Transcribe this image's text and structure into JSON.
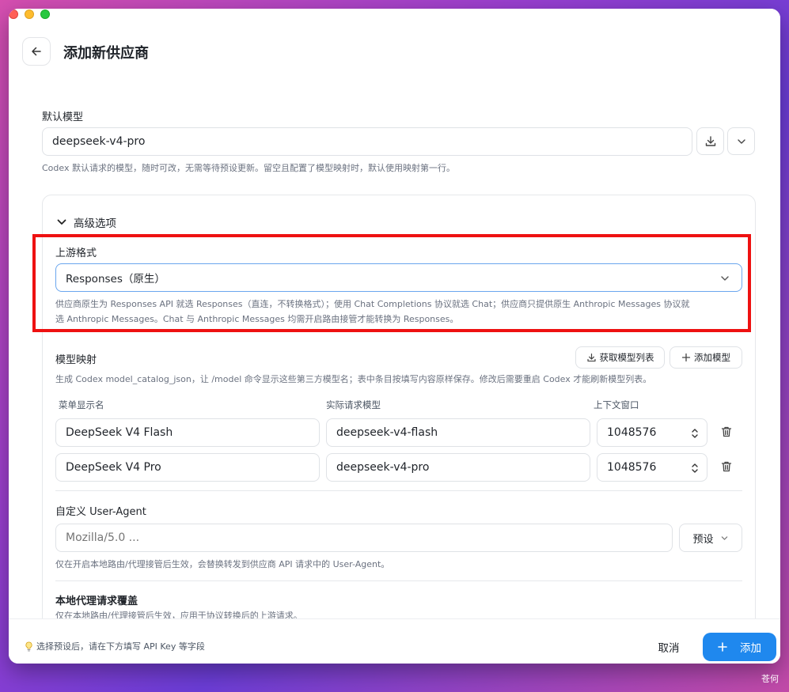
{
  "header": {
    "title": "添加新供应商"
  },
  "default_model": {
    "label": "默认模型",
    "value": "deepseek-v4-pro",
    "hint": "Codex 默认请求的模型，随时可改，无需等待预设更新。留空且配置了模型映射时，默认使用映射第一行。"
  },
  "advanced": {
    "title": "高级选项",
    "upstream": {
      "label": "上游格式",
      "value": "Responses（原生）",
      "hint_line1": "供应商原生为 Responses API 就选 Responses（直连，不转换格式）；使用 Chat Completions 协议就选 Chat；供应商只提供原生 Anthropic Messages 协议就",
      "hint_line2": "选 Anthropic Messages。Chat 与 Anthropic Messages 均需开启路由接管才能转换为 Responses。"
    },
    "model_mapping": {
      "label": "模型映射",
      "fetch_button": "获取模型列表",
      "add_button": "添加模型",
      "hint": "生成 Codex model_catalog_json，让 /model 命令显示这些第三方模型名；表中条目按填写内容原样保存。修改后需要重启 Codex 才能刷新模型列表。",
      "columns": [
        "菜单显示名",
        "实际请求模型",
        "上下文窗口"
      ],
      "rows": [
        {
          "display": "DeepSeek V4 Flash",
          "model": "deepseek-v4-flash",
          "context": "1048576"
        },
        {
          "display": "DeepSeek V4 Pro",
          "model": "deepseek-v4-pro",
          "context": "1048576"
        }
      ]
    },
    "user_agent": {
      "label": "自定义 User-Agent",
      "placeholder": "Mozilla/5.0 ...",
      "preset_button": "预设",
      "hint": "仅在开启本地路由/代理接管后生效，会替换转发到供应商 API 请求中的 User-Agent。"
    },
    "proxy_override": {
      "label": "本地代理请求覆盖",
      "hint": "仅在本地路由/代理接管后生效，应用于协议转换后的上游请求。"
    }
  },
  "footer": {
    "tip": "选择预设后，请在下方填写 API Key 等字段",
    "cancel": "取消",
    "add": "添加"
  },
  "watermark": "苍何",
  "colors": {
    "accent": "#1f88ee",
    "highlight_box": "#ee1111"
  }
}
